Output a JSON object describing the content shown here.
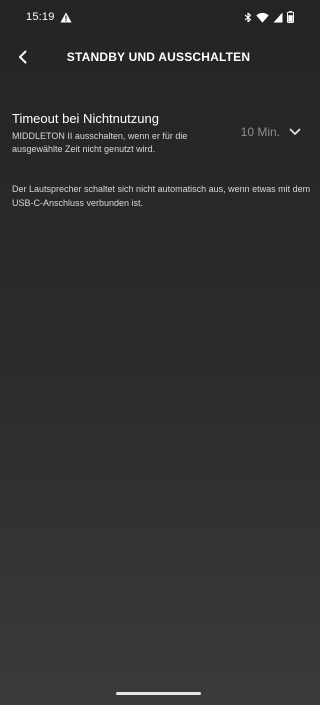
{
  "status_bar": {
    "time": "15:19",
    "icons": [
      "alert-icon",
      "bluetooth-icon",
      "wifi-icon",
      "signal-icon",
      "battery-icon"
    ]
  },
  "header": {
    "back_icon": "chevron-left-icon",
    "title": "STANDBY UND AUSSCHALTEN"
  },
  "setting": {
    "title": "Timeout bei Nichtnutzung",
    "description": "MIDDLETON II ausschalten, wenn er für die ausgewählte Zeit nicht genutzt wird.",
    "value": "10 Min.",
    "dropdown_icon": "chevron-down-icon"
  },
  "info_note": "Der Lautsprecher schaltet sich nicht automatisch aus, wenn etwas mit dem USB-C-Anschluss verbunden ist.",
  "colors": {
    "background_top": "#242424",
    "background_bottom": "#3a3a3a",
    "text_primary": "#ffffff",
    "text_secondary": "#d8d8d8",
    "value_text": "#8e8e8e"
  }
}
